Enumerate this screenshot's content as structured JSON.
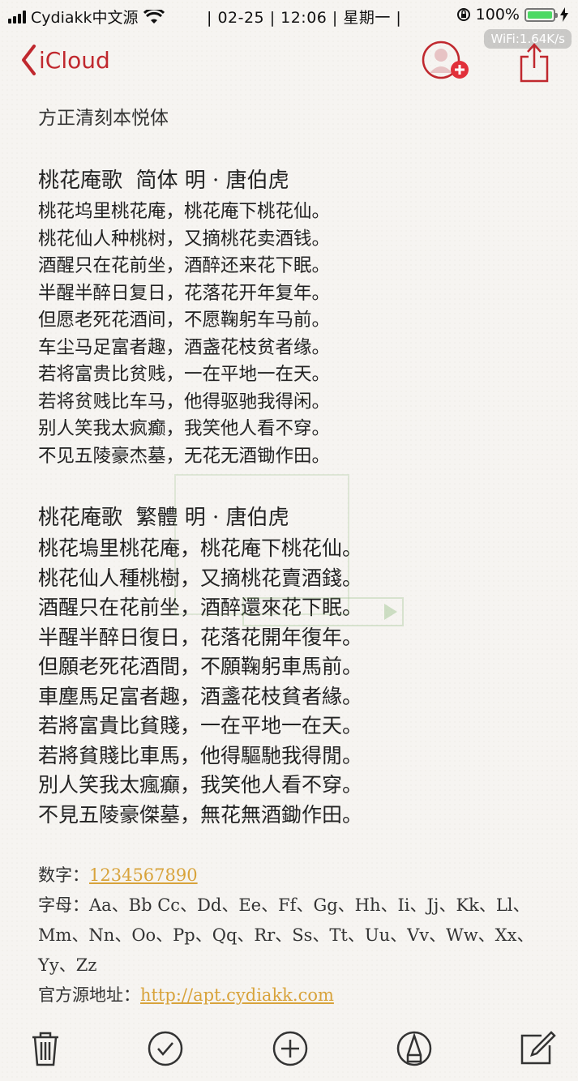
{
  "status_bar": {
    "carrier": "Cydiakk中文源",
    "center": "| 02-25 | 12:06 | 星期一 |",
    "battery_percent": "100%",
    "network_speed": "WiFi:1.64K/s"
  },
  "nav": {
    "back_label": "iCloud",
    "accent_color": "#c0282e"
  },
  "note": {
    "font_name": "方正清刻本悦体",
    "poem_simplified": {
      "title": "桃花庵歌  简体 明 · 唐伯虎",
      "lines": [
        "桃花坞里桃花庵，桃花庵下桃花仙。",
        "桃花仙人种桃树，又摘桃花卖酒钱。",
        "酒醒只在花前坐，酒醉还来花下眠。",
        "半醒半醉日复日，花落花开年复年。",
        "但愿老死花酒间，不愿鞠躬车马前。",
        "车尘马足富者趣，酒盏花枝贫者缘。",
        "若将富贵比贫贱，一在平地一在天。",
        "若将贫贱比车马，他得驱驰我得闲。",
        "别人笑我太疯癫，我笑他人看不穿。",
        "不见五陵豪杰墓，无花无酒锄作田。"
      ]
    },
    "poem_traditional": {
      "title": "桃花庵歌  繁體 明 · 唐伯虎",
      "lines": [
        "桃花塢里桃花庵，桃花庵下桃花仙。",
        "桃花仙人種桃樹，又摘桃花賣酒錢。",
        "酒醒只在花前坐，酒醉還來花下眠。",
        "半醒半醉日復日，花落花開年復年。",
        "但願老死花酒間，不願鞠躬車馬前。",
        "車塵馬足富者趣，酒盞花枝貧者緣。",
        "若將富貴比貧賤，一在平地一在天。",
        "若將貧賤比車馬，他得驅馳我得閒。",
        "別人笑我太瘋癲，我笑他人看不穿。",
        "不見五陵豪傑墓，無花無酒鋤作田。"
      ]
    },
    "digits_label": "数字：",
    "digits_value": "1234567890",
    "letters_label": "字母：",
    "letters_lines": [
      "Aa、Bb Cc、Dd、Ee、Ff、Gg、Hh、Ii、Jj、Kk、Ll、",
      "Mm、Nn、Oo、Pp、Qq、Rr、Ss、Tt、Uu、Vv、Ww、Xx、",
      "Yy、Zz"
    ],
    "source_label": "官方源地址：",
    "source_url": "http://apt.cydiakk.com",
    "link_color": "#d8a33b"
  },
  "toolbar": {
    "icons": [
      "trash-icon",
      "checklist-icon",
      "add-icon",
      "markup-icon",
      "compose-icon"
    ]
  }
}
